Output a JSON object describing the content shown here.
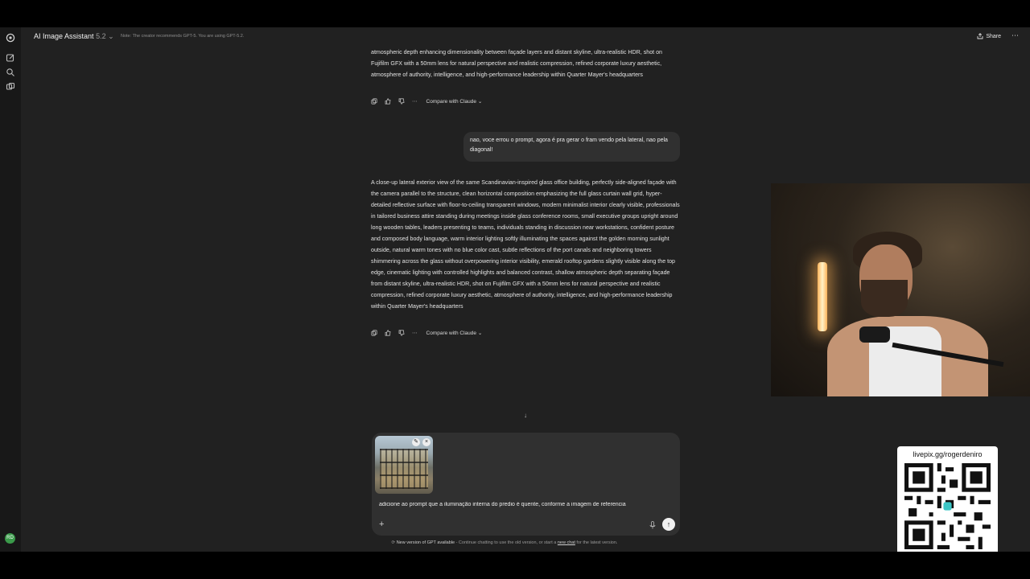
{
  "header": {
    "title": "AI Image Assistant",
    "version": "5.2",
    "note": "Note: The creator recommends GPT-5. You are using GPT-5.2.",
    "share_label": "Share"
  },
  "messages": {
    "previous_tail": "atmospheric depth enhancing dimensionality between façade layers and distant skyline, ultra-realistic HDR, shot on Fujifilm GFX with a 50mm lens for natural perspective and realistic compression, refined corporate luxury aesthetic, atmosphere of authority, intelligence, and high-performance leadership within Quarter Mayer's headquarters",
    "compare_label": "Compare with Claude",
    "user": "nao, voce errou o prompt, agora é pra gerar o fram vendo pela lateral, nao pela diagonal!",
    "assistant": "A close-up lateral exterior view of the same Scandinavian-inspired glass office building, perfectly side-aligned façade with the camera parallel to the structure, clean horizontal composition emphasizing the full glass curtain wall grid, hyper-detailed reflective surface with floor-to-ceiling transparent windows, modern minimalist interior clearly visible, professionals in tailored business attire standing during meetings inside glass conference rooms, small executive groups upright around long wooden tables, leaders presenting to teams, individuals standing in discussion near workstations, confident posture and composed body language, warm interior lighting softly illuminating the spaces against the golden morning sunlight outside, natural warm tones with no blue color cast, subtle reflections of the port canals and neighboring towers shimmering across the glass without overpowering interior visibility, emerald rooftop gardens slightly visible along the top edge, cinematic lighting with controlled highlights and balanced contrast, shallow atmospheric depth separating façade from distant skyline, ultra-realistic HDR, shot on Fujifilm GFX with a 50mm lens for natural perspective and realistic compression, refined corporate luxury aesthetic, atmosphere of authority, intelligence, and high-performance leadership within Quarter Mayer's headquarters"
  },
  "composer": {
    "input_value": "adicione ao prompt que a iluminação interna do predio é quente, conforme a imagem de referencia"
  },
  "footer": {
    "bold": "New version of GPT available",
    "text_1": " - Continue chatting to use the old version, or start a ",
    "link": "new chat",
    "text_2": " for the latest version."
  },
  "overlay": {
    "qr_label": "livepix.gg/rogerdeniro"
  },
  "icons": [
    "openai-logo-icon",
    "new-chat-icon",
    "search-icon",
    "library-icon",
    "chevron-down-icon",
    "share-icon",
    "more-icon",
    "copy-icon",
    "thumbs-up-icon",
    "thumbs-down-icon",
    "ellipsis-icon",
    "arrow-down-icon",
    "edit-icon",
    "close-icon",
    "plus-icon",
    "mic-icon",
    "send-icon",
    "refresh-icon"
  ],
  "colors": {
    "background": "#212121",
    "bubble": "#303030",
    "rail": "#181818"
  }
}
